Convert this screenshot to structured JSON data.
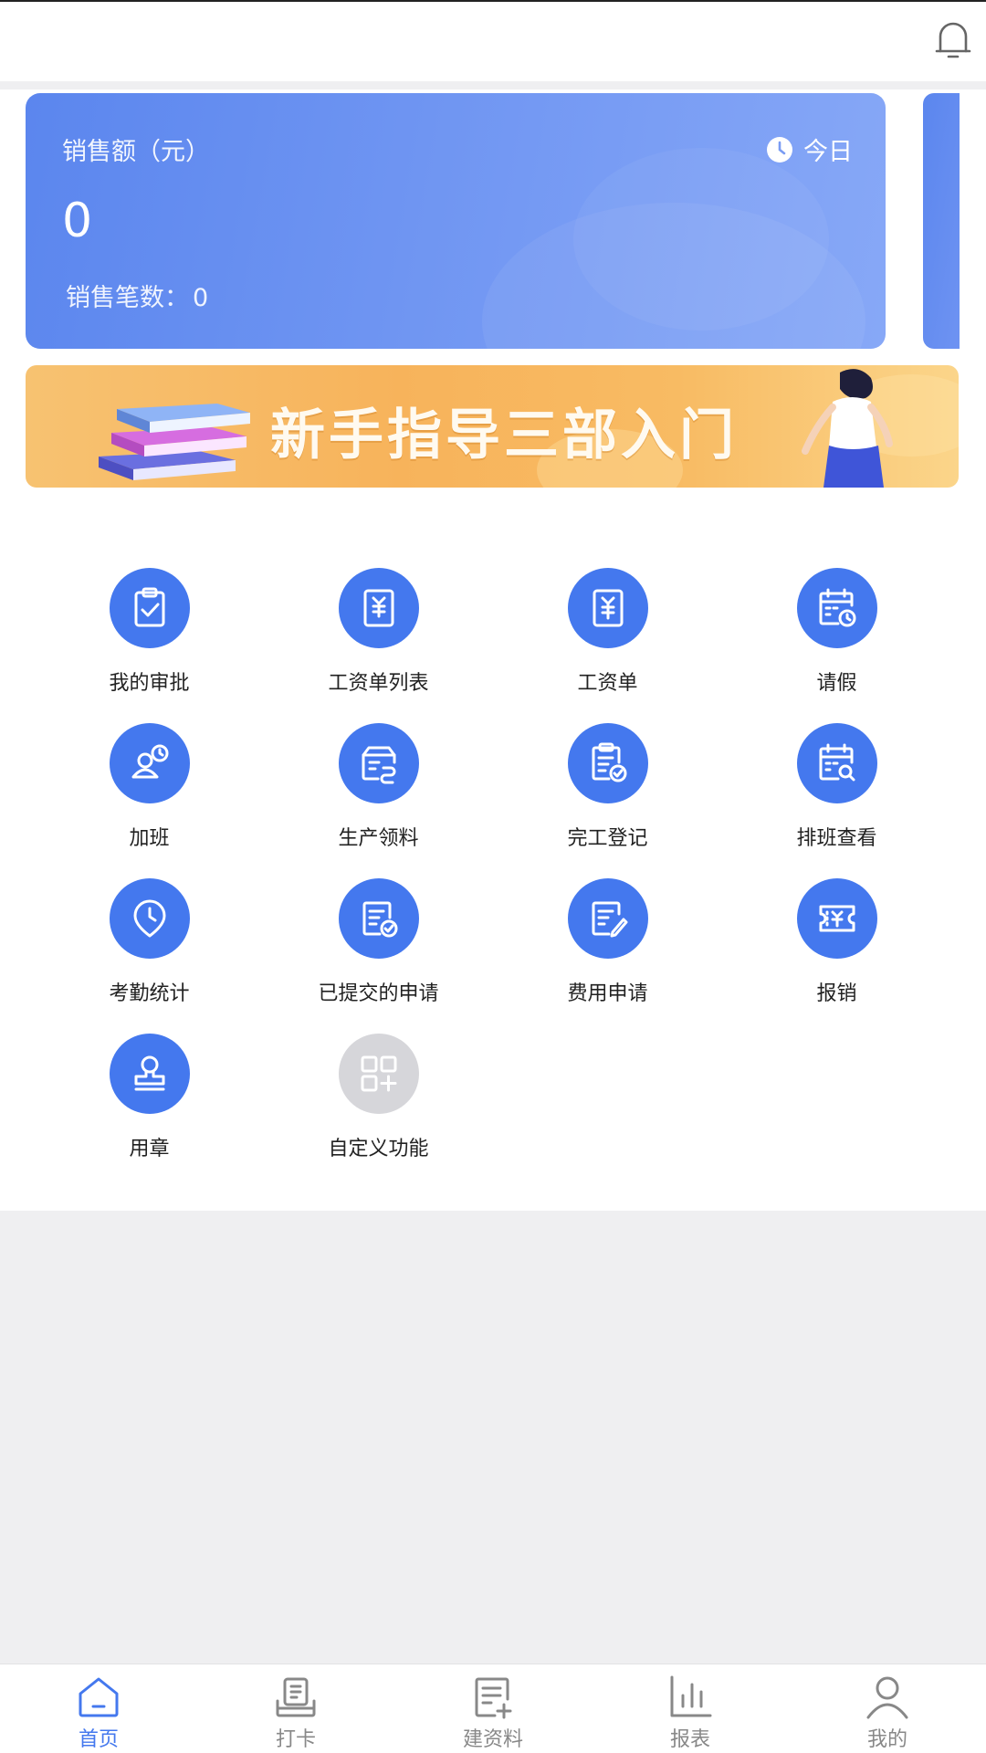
{
  "sales_card": {
    "title": "销售额（元）",
    "period": "今日",
    "amount": "0",
    "count_label": "销售笔数：",
    "count_value": "0"
  },
  "banner": {
    "text": "新手指导三部入门"
  },
  "functions": [
    {
      "label": "我的审批",
      "icon": "approval-clipboard-icon"
    },
    {
      "label": "工资单列表",
      "icon": "payroll-list-icon"
    },
    {
      "label": "工资单",
      "icon": "payslip-icon"
    },
    {
      "label": "请假",
      "icon": "leave-calendar-icon"
    },
    {
      "label": "加班",
      "icon": "overtime-icon"
    },
    {
      "label": "生产领料",
      "icon": "material-requisition-icon"
    },
    {
      "label": "完工登记",
      "icon": "completion-registration-icon"
    },
    {
      "label": "排班查看",
      "icon": "schedule-search-icon"
    },
    {
      "label": "考勤统计",
      "icon": "attendance-clock-icon"
    },
    {
      "label": "已提交的申请",
      "icon": "submitted-application-icon"
    },
    {
      "label": "费用申请",
      "icon": "expense-application-icon"
    },
    {
      "label": "报销",
      "icon": "reimbursement-icon"
    },
    {
      "label": "用章",
      "icon": "seal-stamp-icon"
    },
    {
      "label": "自定义功能",
      "icon": "custom-add-icon"
    }
  ],
  "tabbar": [
    {
      "label": "首页",
      "icon": "home-icon",
      "active": true
    },
    {
      "label": "打卡",
      "icon": "punch-card-icon",
      "active": false
    },
    {
      "label": "建资料",
      "icon": "create-document-icon",
      "active": false
    },
    {
      "label": "报表",
      "icon": "report-chart-icon",
      "active": false
    },
    {
      "label": "我的",
      "icon": "profile-icon",
      "active": false
    }
  ],
  "colors": {
    "primary": "#4478ee",
    "banner_orange": "#f7b35b",
    "background": "#efeff1"
  }
}
